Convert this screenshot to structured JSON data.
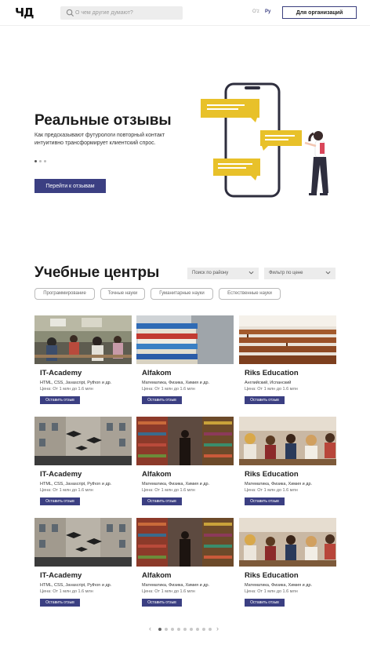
{
  "header": {
    "logo": "ЧД",
    "search_placeholder": "О чем другие думают?",
    "lang_uz": "O'z",
    "lang_ru": "Ру",
    "org_button": "Для организаций"
  },
  "hero": {
    "title": "Реальные отзывы",
    "text": "Как предсказывают футурологи повторный контакт интуитивно трансформирует клиентский спрос.",
    "button": "Перейти к отзывам"
  },
  "centers": {
    "title": "Учебные центры",
    "select_region": "Поиск по району",
    "select_price": "Фильтр по цене",
    "chips": [
      "Программирование",
      "Точные науки",
      "Гуманитарные науки",
      "Естественные науки"
    ],
    "cards": [
      {
        "name": "IT-Academy",
        "subjects": "HTML, CSS, Javascript, Python и др.",
        "price": "Цена: От 1 млн до 1.6 млн",
        "button": "Оставить отзыв"
      },
      {
        "name": "Alfakom",
        "subjects": "Математика, Физика, Химия и др.",
        "price": "Цена: От 1 млн до 1.6 млн",
        "button": "Оставить отзыв"
      },
      {
        "name": "Riks Education",
        "subjects": "Английский, Испанский",
        "price": "Цена: От 1 млн до 1.6 млн",
        "button": "Оставить отзыв"
      },
      {
        "name": "IT-Academy",
        "subjects": "HTML, CSS, Javascript, Python и др.",
        "price": "Цена: От 1 млн до 1.6 млн",
        "button": "Оставить отзыв"
      },
      {
        "name": "Alfakom",
        "subjects": "Математика, Физика, Химия и др.",
        "price": "Цена: От 1 млн до 1.6 млн",
        "button": "Оставить отзыв"
      },
      {
        "name": "Riks Education",
        "subjects": "Математика, Физика, Химия и др.",
        "price": "Цена: От 1 млн до 1.6 млн",
        "button": "Оставить отзыв"
      },
      {
        "name": "IT-Academy",
        "subjects": "HTML, CSS, Javascript, Python и др.",
        "price": "Цена: От 1 млн до 1.6 млн",
        "button": "Оставить отзыв"
      },
      {
        "name": "Alfakom",
        "subjects": "Математика, Физика, Химия и др.",
        "price": "Цена: От 1 млн до 1.6 млн",
        "button": "Оставить отзыв"
      },
      {
        "name": "Riks Education",
        "subjects": "Математика, Физика, Химия и др.",
        "price": "Цена: От 1 млн до 1.6 млн",
        "button": "Оставить отзыв"
      }
    ]
  },
  "pagination": {
    "prev_icon": "chevron-left-icon",
    "next_icon": "chevron-right-icon",
    "active_index": 0
  },
  "colors": {
    "accent": "#3b3f82",
    "yellow": "#e8c12a"
  }
}
